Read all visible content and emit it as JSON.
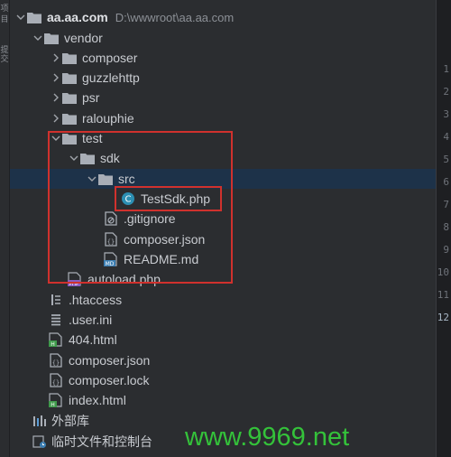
{
  "left_strip": {
    "text_top": "项",
    "text_mid": "目",
    "text_low": "提交"
  },
  "project": {
    "root_name": "aa.aa.com",
    "root_path": "D:\\wwwroot\\aa.aa.com"
  },
  "tree": {
    "vendor": "vendor",
    "composer": "composer",
    "guzzlehttp": "guzzlehttp",
    "psr": "psr",
    "ralouphie": "ralouphie",
    "test": "test",
    "sdk": "sdk",
    "src": "src",
    "testsdk": "TestSdk.php",
    "gitignore": ".gitignore",
    "composer_json_inner": "composer.json",
    "readme": "README.md",
    "autoload": "autoload.php",
    "htaccess": ".htaccess",
    "user_ini": ".user.ini",
    "html404": "404.html",
    "composer_json": "composer.json",
    "composer_lock": "composer.lock",
    "index_html": "index.html",
    "external_libs": "外部库",
    "scratches": "临时文件和控制台"
  },
  "gutter_numbers": [
    "1",
    "2",
    "3",
    "4",
    "5",
    "6",
    "7",
    "8",
    "9",
    "10",
    "11",
    "12"
  ],
  "watermark": "www.9969.net",
  "colors": {
    "background": "#2b2d30",
    "selection": "#1d3249",
    "highlight_box": "#d0312d",
    "folder_icon": "#a9aeb6",
    "php_class_icon": "#2c8fb3",
    "watermark": "#34c23a"
  }
}
